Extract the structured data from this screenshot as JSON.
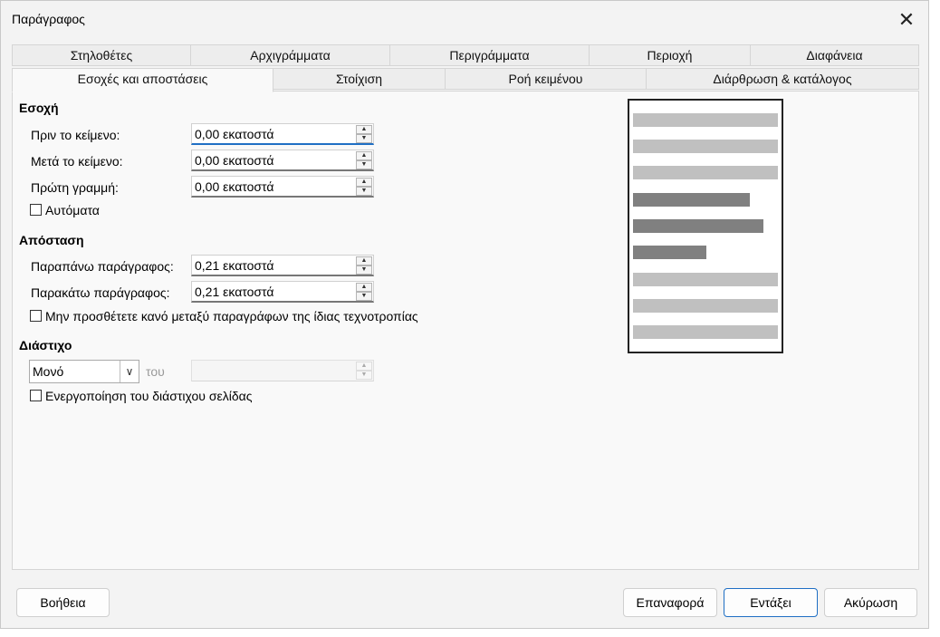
{
  "window": {
    "title": "Παράγραφος",
    "close_icon": "✕"
  },
  "tabs_row1": [
    {
      "label": "Στηλοθέτες"
    },
    {
      "label": "Αρχιγράμματα"
    },
    {
      "label": "Περιγράμματα"
    },
    {
      "label": "Περιοχή"
    },
    {
      "label": "Διαφάνεια"
    }
  ],
  "tabs_row2": [
    {
      "label": "Εσοχές και αποστάσεις",
      "active": true
    },
    {
      "label": "Στοίχιση"
    },
    {
      "label": "Ροή κειμένου"
    },
    {
      "label": "Διάρθρωση & κατάλογος"
    }
  ],
  "indent": {
    "heading": "Εσοχή",
    "before_label": "Πριν το κείμενο:",
    "before_value": "0,00 εκατοστά",
    "after_label": "Μετά το κείμενο:",
    "after_value": "0,00 εκατοστά",
    "first_label": "Πρώτη γραμμή:",
    "first_value": "0,00 εκατοστά",
    "auto_label": "Αυτόματα",
    "auto_checked": false
  },
  "spacing": {
    "heading": "Απόσταση",
    "above_label": "Παραπάνω παράγραφος:",
    "above_value": "0,21 εκατοστά",
    "below_label": "Παρακάτω παράγραφος:",
    "below_value": "0,21 εκατοστά",
    "no_space_label": "Μην προσθέτετε κανό μεταξύ παραγράφων της ίδιας τεχνοτροπίας",
    "no_space_checked": false
  },
  "line_spacing": {
    "heading": "Διάστιχο",
    "selected": "Μονό",
    "of_label": "του",
    "of_value": "",
    "register_label": "Ενεργοποίηση του διάστιχου σελίδας",
    "register_checked": false
  },
  "icons": {
    "spin_up": "▲",
    "spin_down": "▼",
    "dropdown": "∨"
  },
  "buttons": {
    "help": "Βοήθεια",
    "reset": "Επαναφορά",
    "ok": "Εντάξει",
    "cancel": "Ακύρωση"
  },
  "colors": {
    "preview_light": "#c0c0c0",
    "preview_dark": "#808080",
    "focus_accent": "#1f6fc4"
  }
}
